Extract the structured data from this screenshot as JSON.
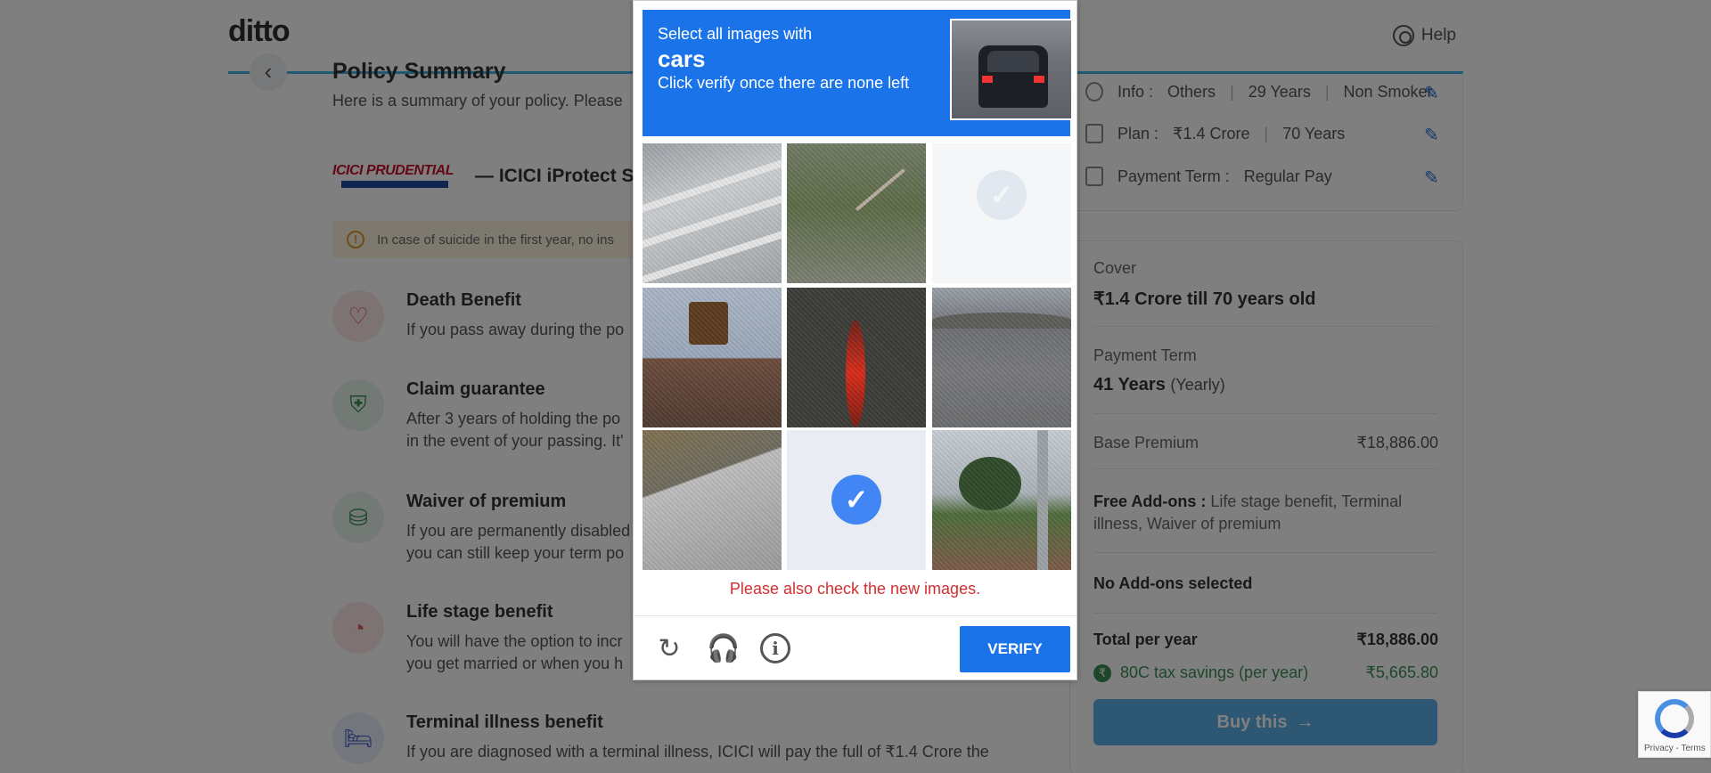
{
  "header": {
    "logo": "ditto",
    "help_label": "Help"
  },
  "summary": {
    "title": "Policy Summary",
    "subtitle": "Here is a summary of your policy. Please",
    "insurer_logo_text": "ICICI PRUDENTIAL",
    "plan_name": "— ICICI iProtect Sm",
    "notice": "In case of suicide in the first year, no ins",
    "benefits": [
      {
        "title": "Death Benefit",
        "desc": [
          "If you pass away during the po"
        ]
      },
      {
        "title": "Claim guarantee",
        "desc": [
          "After 3 years of holding the po",
          "in the event of your passing. It'"
        ]
      },
      {
        "title": "Waiver of premium",
        "desc": [
          "If you are permanently disabled",
          "you can still keep your term po"
        ]
      },
      {
        "title": "Life stage benefit",
        "desc": [
          "You will have the option to incr",
          "you get married or when you h"
        ]
      },
      {
        "title": "Terminal illness benefit",
        "desc": [
          "If you are diagnosed with a terminal illness, ICICI will pay the full of ₹1.4 Crore the"
        ]
      }
    ]
  },
  "profile": {
    "info_label": "Info :",
    "info_values": [
      "Others",
      "29 Years",
      "Non Smoker"
    ],
    "plan_label": "Plan :",
    "plan_values": [
      "₹1.4 Crore",
      "70 Years"
    ],
    "payterm_label": "Payment Term :",
    "payterm_value": "Regular Pay"
  },
  "quote": {
    "cover_label": "Cover",
    "cover_value": "₹1.4 Crore till 70 years old",
    "payterm_label": "Payment Term",
    "payterm_value": "41 Years",
    "payterm_freq": "(Yearly)",
    "base_label": "Base Premium",
    "base_value": "₹18,886.00",
    "addons_label": "Free Add-ons :",
    "addons_line1": "Life stage benefit, Terminal",
    "addons_line2": "illness, Waiver of premium",
    "no_addons": "No Add-ons selected",
    "total_label": "Total per year",
    "total_value": "₹18,886.00",
    "tax_label": "80C tax savings (per year)",
    "tax_value": "₹5,665.80",
    "buy_label": "Buy this"
  },
  "captcha": {
    "line1": "Select all images with",
    "target": "cars",
    "line3": "Click verify once there are none left",
    "error": "Please also check the new images.",
    "verify_label": "VERIFY",
    "selected_tiles": [
      8
    ]
  },
  "badge": {
    "links": "Privacy - Terms"
  },
  "colors": {
    "accent": "#1a73e8",
    "error": "#d32f2f",
    "brand_progress": "#41b4e6"
  }
}
